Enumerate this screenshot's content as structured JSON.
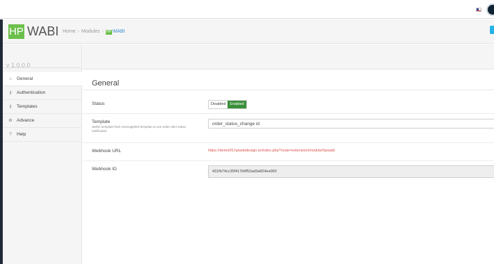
{
  "header": {
    "logo_badge": "HP",
    "app_title": "WABI",
    "breadcrumb": {
      "home": "Home",
      "modules": "Modules",
      "current_badge": "HP",
      "current": "WABI"
    }
  },
  "sidebar": {
    "version": "v 1.0.0.0",
    "items": [
      {
        "label": "General",
        "icon": "home-icon",
        "active": true
      },
      {
        "label": "Authentication",
        "icon": "key-icon",
        "active": false
      },
      {
        "label": "Templates",
        "icon": "key-icon",
        "active": false
      },
      {
        "label": "Advance",
        "icon": "cogs-icon",
        "active": false
      },
      {
        "label": "Help",
        "icon": "question-circle-icon",
        "active": false
      }
    ]
  },
  "main": {
    "title": "General",
    "status": {
      "label": "Status",
      "options": [
        "Disabled",
        "Enabled"
      ],
      "selected": "Enabled"
    },
    "template": {
      "label": "Template",
      "hint": "Select template from messagebird template to use order alert status notification",
      "value": "order_status_change id"
    },
    "webhook_url": {
      "label": "Webhook URL",
      "value": "https://demo06.hpwebdesign.io/index.php?route=extension/module/hpwabi"
    },
    "webhook_id": {
      "label": "Webhook ID",
      "value": "431fb74cc35f417b9f52ad3a824ee060"
    }
  },
  "colors": {
    "brand_green": "#6bbf4a",
    "enabled_green": "#3a8f3a",
    "link_red": "#d9534f",
    "crumb_blue": "#3a8fd0",
    "help_tab_blue": "#27b2e6"
  }
}
